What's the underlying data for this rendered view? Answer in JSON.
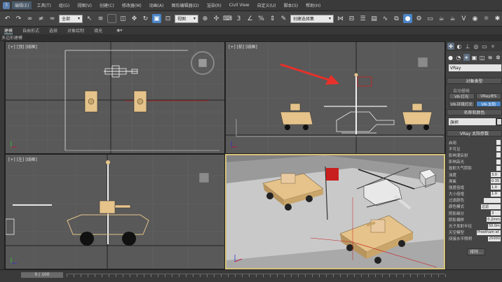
{
  "menubar": {
    "items": [
      {
        "label": "编辑(E)"
      },
      {
        "label": "工具(T)"
      },
      {
        "label": "组(G)"
      },
      {
        "label": "视图(V)"
      },
      {
        "label": "创建(C)"
      },
      {
        "label": "修改器(M)"
      },
      {
        "label": "动画(A)"
      },
      {
        "label": "图形编辑器(D)"
      },
      {
        "label": "渲染(R)"
      },
      {
        "label": "Civil View"
      },
      {
        "label": "自定义(U)"
      },
      {
        "label": "脚本(S)"
      },
      {
        "label": "帮助(H)"
      }
    ]
  },
  "toolbar": {
    "filter_dropdown": "全部",
    "view_dropdown": "视图",
    "selection_set_dropdown": "创建选择集"
  },
  "subbar": {
    "tabs": [
      "建模",
      "自由形式",
      "选择",
      "对象绘制",
      "填充"
    ],
    "active_index": 0
  },
  "ribbon_label": "多边形建模",
  "viewports": {
    "top": {
      "label": "[+] [顶] [线框]"
    },
    "front": {
      "label": "[+] [前] [线框]"
    },
    "left": {
      "label": "[+] [左] [线框]"
    },
    "persp": {
      "label": ""
    }
  },
  "command_panel": {
    "category_dropdown": "VRay",
    "object_type_header": "对象类型",
    "autogrid": "自动栅格",
    "buttons": [
      {
        "label": "VR-灯光",
        "selected": false
      },
      {
        "label": "VRayIES",
        "selected": false
      },
      {
        "label": "VR-环境灯光",
        "selected": false
      },
      {
        "label": "VR-太阳",
        "selected": true
      }
    ],
    "name_color_header": "名称和颜色",
    "name_value": "旗帜",
    "vray_sun_header": "VRay 太阳参数",
    "params": [
      {
        "label": "启用",
        "value": ""
      },
      {
        "label": "不可见",
        "value": ""
      },
      {
        "label": "影响漫反射",
        "value": ""
      },
      {
        "label": "影响高光",
        "value": ""
      },
      {
        "label": "投射大气阴影",
        "value": ""
      },
      {
        "label": "浊度",
        "value": "3.0"
      },
      {
        "label": "臭氧",
        "value": "0.35"
      },
      {
        "label": "强度倍增",
        "value": "1.0"
      },
      {
        "label": "大小倍增",
        "value": "1.0"
      },
      {
        "label": "过滤颜色",
        "value": ""
      },
      {
        "label": "颜色模式",
        "value": "过滤"
      },
      {
        "label": "阴影细分",
        "value": "3"
      },
      {
        "label": "阴影偏移",
        "value": "0.2mm"
      },
      {
        "label": "光子发射半径",
        "value": "50.0m"
      },
      {
        "label": "天空模型",
        "value": "Preetham et"
      },
      {
        "label": "间接水平照明",
        "value": "25000"
      }
    ],
    "exclude_button": "排除..."
  },
  "timeline": {
    "frame_label": "0 / 100"
  },
  "colors": {
    "accent_blue": "#4b86c8",
    "tank_tan": "#e5c38a",
    "flag_red": "#c8201e",
    "arrow_red": "#e8302a",
    "persp_frame": "#d4c27a"
  }
}
